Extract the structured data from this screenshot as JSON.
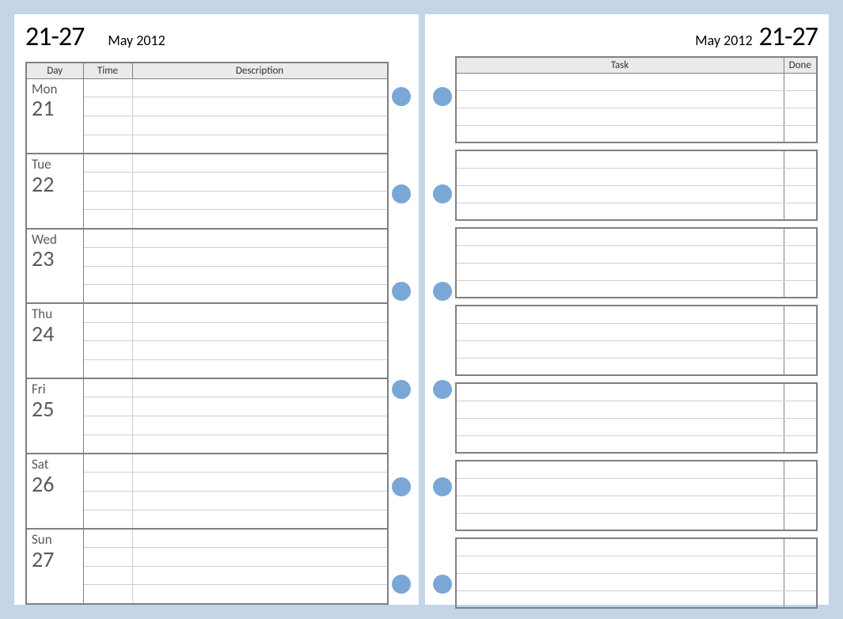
{
  "left": {
    "date_range": "21-27",
    "month_year": "May 2012",
    "headers": {
      "day": "Day",
      "time": "Time",
      "description": "Description"
    },
    "days": [
      {
        "name": "Mon",
        "num": "21"
      },
      {
        "name": "Tue",
        "num": "22"
      },
      {
        "name": "Wed",
        "num": "23"
      },
      {
        "name": "Thu",
        "num": "24"
      },
      {
        "name": "Fri",
        "num": "25"
      },
      {
        "name": "Sat",
        "num": "26"
      },
      {
        "name": "Sun",
        "num": "27"
      }
    ]
  },
  "right": {
    "date_range": "21-27",
    "month_year": "May 2012",
    "headers": {
      "task": "Task",
      "done": "Done"
    }
  }
}
